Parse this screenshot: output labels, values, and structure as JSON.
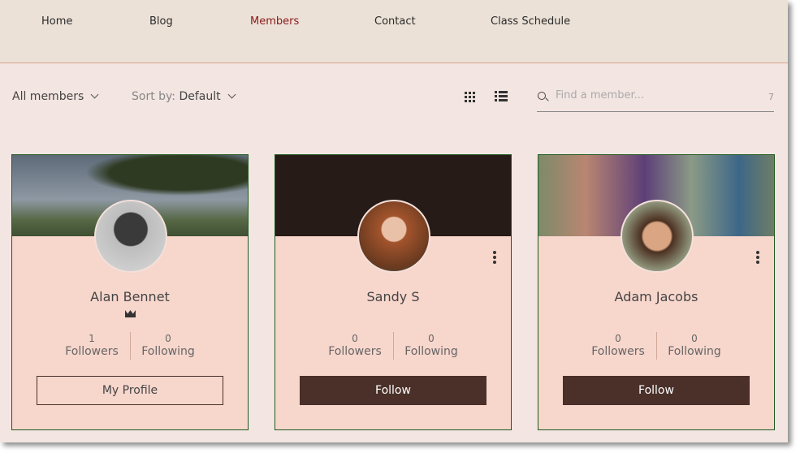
{
  "nav": {
    "items": [
      {
        "label": "Home"
      },
      {
        "label": "Blog"
      },
      {
        "label": "Members",
        "active": true
      },
      {
        "label": "Contact"
      },
      {
        "label": "Class Schedule"
      }
    ]
  },
  "toolbar": {
    "filter": "All members",
    "sort_label": "Sort by:",
    "sort_value": "Default",
    "search_placeholder": "Find a member...",
    "member_count": "7"
  },
  "colors": {
    "active_nav": "#8b1a1a",
    "card_bg": "#f7d6cc",
    "button": "#4a3029",
    "card_border": "#1f5a1f"
  },
  "members": [
    {
      "name": "Alan Bennet",
      "followers": "1",
      "followers_label": "Followers",
      "following": "0",
      "following_label": "Following",
      "button": "My Profile",
      "badge": "crown-icon"
    },
    {
      "name": "Sandy S",
      "followers": "0",
      "followers_label": "Followers",
      "following": "0",
      "following_label": "Following",
      "button": "Follow"
    },
    {
      "name": "Adam Jacobs",
      "followers": "0",
      "followers_label": "Followers",
      "following": "0",
      "following_label": "Following",
      "button": "Follow"
    }
  ]
}
